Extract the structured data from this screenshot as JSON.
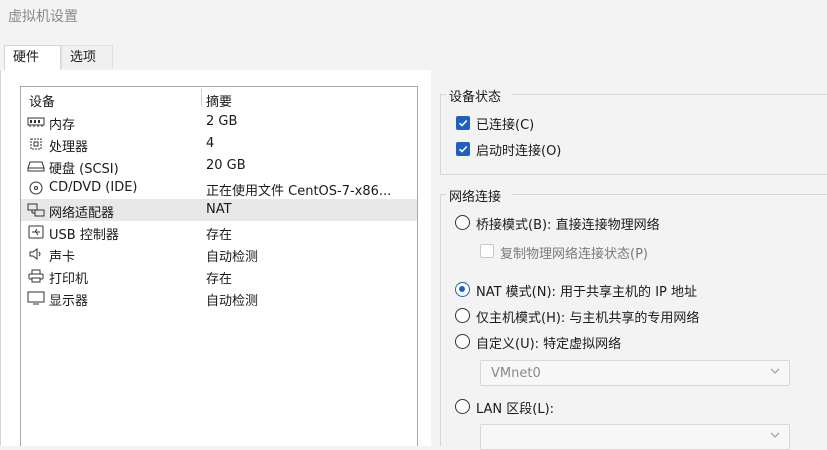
{
  "window": {
    "title": "虚拟机设置"
  },
  "tabs": [
    {
      "label": "硬件"
    },
    {
      "label": "选项"
    }
  ],
  "device_list": {
    "headers": {
      "device": "设备",
      "summary": "摘要"
    },
    "rows": [
      {
        "icon": "memory-icon",
        "name": "内存",
        "summary": "2 GB"
      },
      {
        "icon": "processor-icon",
        "name": "处理器",
        "summary": "4"
      },
      {
        "icon": "harddisk-icon",
        "name": "硬盘 (SCSI)",
        "summary": "20 GB"
      },
      {
        "icon": "cd-dvd-icon",
        "name": "CD/DVD (IDE)",
        "summary": "正在使用文件 CentOS-7-x86..."
      },
      {
        "icon": "network-adapter-icon",
        "name": "网络适配器",
        "summary": "NAT"
      },
      {
        "icon": "usb-icon",
        "name": "USB 控制器",
        "summary": "存在"
      },
      {
        "icon": "sound-card-icon",
        "name": "声卡",
        "summary": "自动检测"
      },
      {
        "icon": "printer-icon",
        "name": "打印机",
        "summary": "存在"
      },
      {
        "icon": "display-icon",
        "name": "显示器",
        "summary": "自动检测"
      }
    ],
    "selected": "网络适配器"
  },
  "device_status": {
    "title": "设备状态",
    "connected": {
      "label": "已连接(C)",
      "checked": true
    },
    "connect_on_power_on": {
      "label": "启动时连接(O)",
      "checked": true
    }
  },
  "network_connection": {
    "title": "网络连接",
    "bridged": {
      "label": "桥接模式(B): 直接连接物理网络",
      "selected": false
    },
    "replicate_state": {
      "label": "复制物理网络连接状态(P)",
      "checked": false,
      "enabled": false
    },
    "nat": {
      "label": "NAT 模式(N): 用于共享主机的 IP 地址",
      "selected": true
    },
    "host_only": {
      "label": "仅主机模式(H): 与主机共享的专用网络",
      "selected": false
    },
    "custom": {
      "label": "自定义(U): 特定虚拟网络",
      "selected": false
    },
    "custom_select": {
      "value": "VMnet0"
    },
    "lan_segment": {
      "label": "LAN 区段(L):",
      "selected": false
    },
    "lan_select": {
      "value": ""
    }
  },
  "colors": {
    "accent": "#1f5fbf",
    "selected_row": "#e8e8e8"
  }
}
